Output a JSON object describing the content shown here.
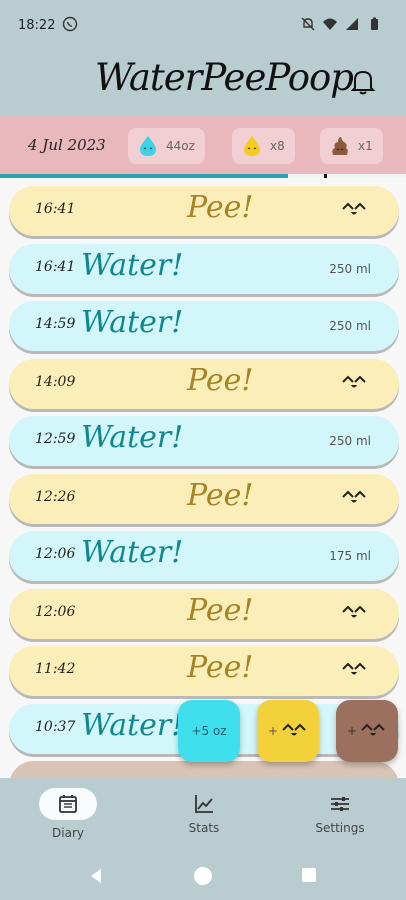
{
  "status_bar": {
    "time": "18:22"
  },
  "header": {
    "title": "WaterPeePoop"
  },
  "summary": {
    "date": "4 Jul 2023",
    "water_total": "44oz",
    "pee_count": "x8",
    "poop_count": "x1",
    "progress_fraction": 0.71
  },
  "entries": [
    {
      "type": "pee",
      "time": "16:41",
      "label": "Pee!"
    },
    {
      "type": "water",
      "time": "16:41",
      "label": "Water!",
      "amount": "250 ml"
    },
    {
      "type": "water",
      "time": "14:59",
      "label": "Water!",
      "amount": "250 ml"
    },
    {
      "type": "pee",
      "time": "14:09",
      "label": "Pee!"
    },
    {
      "type": "water",
      "time": "12:59",
      "label": "Water!",
      "amount": "250 ml"
    },
    {
      "type": "pee",
      "time": "12:26",
      "label": "Pee!"
    },
    {
      "type": "water",
      "time": "12:06",
      "label": "Water!",
      "amount": "175 ml"
    },
    {
      "type": "pee",
      "time": "12:06",
      "label": "Pee!"
    },
    {
      "type": "pee",
      "time": "11:42",
      "label": "Pee!"
    },
    {
      "type": "water",
      "time": "10:37",
      "label": "Water!"
    },
    {
      "type": "poop",
      "time": "",
      "label": ""
    }
  ],
  "fabs": {
    "water_label": "+5 oz",
    "pee_prefix": "+",
    "poop_prefix": "+"
  },
  "nav": {
    "diary": "Diary",
    "stats": "Stats",
    "settings": "Settings",
    "active": "diary"
  },
  "colors": {
    "pee": "#fbeeb8",
    "water": "#d3f6fa",
    "poop": "#d8c3b5",
    "accent": "#2aa3b0",
    "summary_bg": "#e9b8bd"
  },
  "icons": {
    "water_drop": "water-drop-icon",
    "pee_drop": "pee-drop-icon",
    "poop": "poop-icon",
    "bell": "bell-icon",
    "diary": "diary-icon",
    "stats": "stats-icon",
    "settings": "settings-icon"
  }
}
